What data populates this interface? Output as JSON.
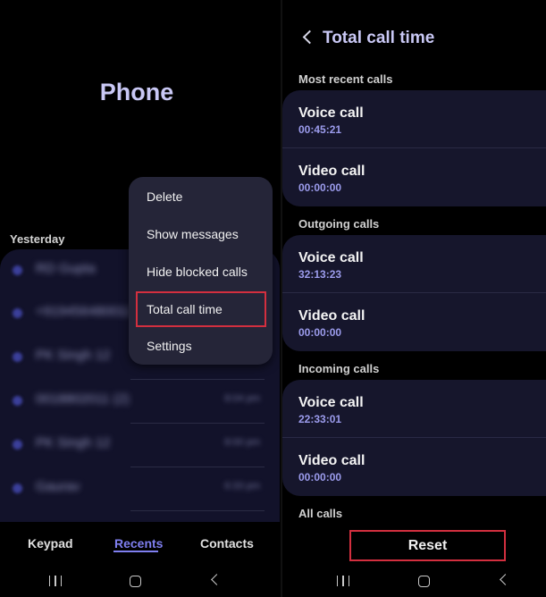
{
  "left": {
    "app_title": "Phone",
    "section_label": "Yesterday",
    "recent_calls": [
      {
        "name": "RD Gupta",
        "time": ""
      },
      {
        "name": "+919456480011",
        "time": ""
      },
      {
        "name": "PK Singh 12",
        "time": ""
      },
      {
        "name": "0018802011 (2)",
        "time": "8:04 pm"
      },
      {
        "name": "PK Singh 12",
        "time": "8:00 pm"
      },
      {
        "name": "Gaurav",
        "time": "6:33 pm"
      }
    ],
    "menu": {
      "items": [
        "Delete",
        "Show messages",
        "Hide blocked calls",
        "Total call time",
        "Settings"
      ]
    },
    "bottom_nav": {
      "tabs": [
        "Keypad",
        "Recents",
        "Contacts"
      ],
      "active": "Recents"
    }
  },
  "right": {
    "title": "Total call time",
    "groups": [
      {
        "label": "Most recent calls",
        "voice_label": "Voice call",
        "voice_duration": "00:45:21",
        "video_label": "Video call",
        "video_duration": "00:00:00"
      },
      {
        "label": "Outgoing calls",
        "voice_label": "Voice call",
        "voice_duration": "32:13:23",
        "video_label": "Video call",
        "video_duration": "00:00:00"
      },
      {
        "label": "Incoming calls",
        "voice_label": "Voice call",
        "voice_duration": "22:33:01",
        "video_label": "Video call",
        "video_duration": "00:00:00"
      }
    ],
    "all_calls_label": "All calls",
    "reset_label": "Reset"
  },
  "highlight_color": "#d32f3f",
  "accent_color": "#7f7ff0",
  "icons": [
    "back-chevron-icon",
    "recent-apps-icon",
    "home-icon",
    "back-icon"
  ]
}
